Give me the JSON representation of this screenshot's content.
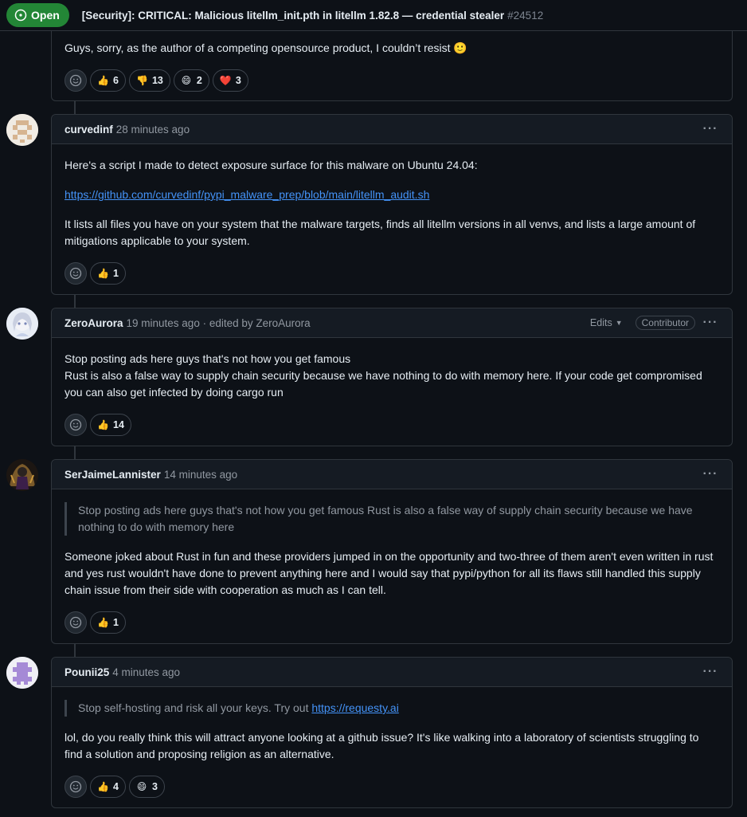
{
  "header": {
    "state": "Open",
    "title": "[Security]: CRITICAL: Malicious litellm_init.pth in litellm 1.82.8 — credential stealer",
    "number": "#24512"
  },
  "comments": [
    {
      "body": [
        "Guys, sorry, as the author of a competing opensource product, I couldn’t resist 🙂"
      ],
      "reactions": [
        {
          "emoji": "👍",
          "emoji_name": "thumbs-up-icon",
          "count": "6"
        },
        {
          "emoji": "👎",
          "emoji_name": "thumbs-down-icon",
          "count": "13"
        },
        {
          "emoji": "😄",
          "emoji_name": "laugh-icon",
          "count": "2"
        },
        {
          "emoji": "❤️",
          "emoji_name": "heart-icon",
          "count": "3"
        }
      ]
    },
    {
      "author": "curvedinf",
      "meta": "28 minutes ago",
      "body": [
        "Here's a script I made to detect exposure surface for this malware on Ubuntu 24.04:",
        "https://github.com/curvedinf/pypi_malware_prep/blob/main/litellm_audit.sh",
        "It lists all files you have on your system that the malware targets, finds all litellm versions in all venvs, and lists a large amount of mitigations applicable to your system."
      ],
      "reactions": [
        {
          "emoji": "👍",
          "emoji_name": "thumbs-up-icon",
          "count": "1"
        }
      ]
    },
    {
      "author": "ZeroAurora",
      "meta": "19 minutes ago · edited by ZeroAurora",
      "edits_label": "Edits",
      "role": "Contributor",
      "body": [
        "Stop posting ads here guys that's not how you get famous",
        "Rust is also a false way to supply chain security because we have nothing to do with memory here. If your code get compromised you can also get infected by doing cargo run"
      ],
      "reactions": [
        {
          "emoji": "👍",
          "emoji_name": "thumbs-up-icon",
          "count": "14"
        }
      ]
    },
    {
      "author": "SerJaimeLannister",
      "meta": "14 minutes ago",
      "quote": "Stop posting ads here guys that's not how you get famous Rust is also a false way of supply chain security because we have nothing to do with memory here",
      "body": [
        "Someone joked about Rust in fun and these providers jumped in on the opportunity and two-three of them aren't even written in rust and yes rust wouldn't have done to prevent anything here and I would say that pypi/python for all its flaws still handled this supply chain issue from their side with cooperation as much as I can tell."
      ],
      "reactions": [
        {
          "emoji": "👍",
          "emoji_name": "thumbs-up-icon",
          "count": "1"
        }
      ]
    },
    {
      "author": "Pounii25",
      "meta": "4 minutes ago",
      "quote_text": "Stop self-hosting and risk all your keys. Try out",
      "quote_link": "https://requesty.ai",
      "body": [
        "lol, do you really think this will attract anyone looking at a github issue? It's like walking into a laboratory of scientists struggling to find a solution and proposing religion as an alternative."
      ],
      "reactions": [
        {
          "emoji": "👍",
          "emoji_name": "thumbs-up-icon",
          "count": "4"
        },
        {
          "emoji": "😄",
          "emoji_name": "laugh-icon",
          "count": "3"
        }
      ]
    }
  ],
  "colors": {
    "background": "#0d1117",
    "border": "#30363d",
    "open_green": "#238636",
    "link": "#4493f8",
    "muted": "#9198a1"
  }
}
